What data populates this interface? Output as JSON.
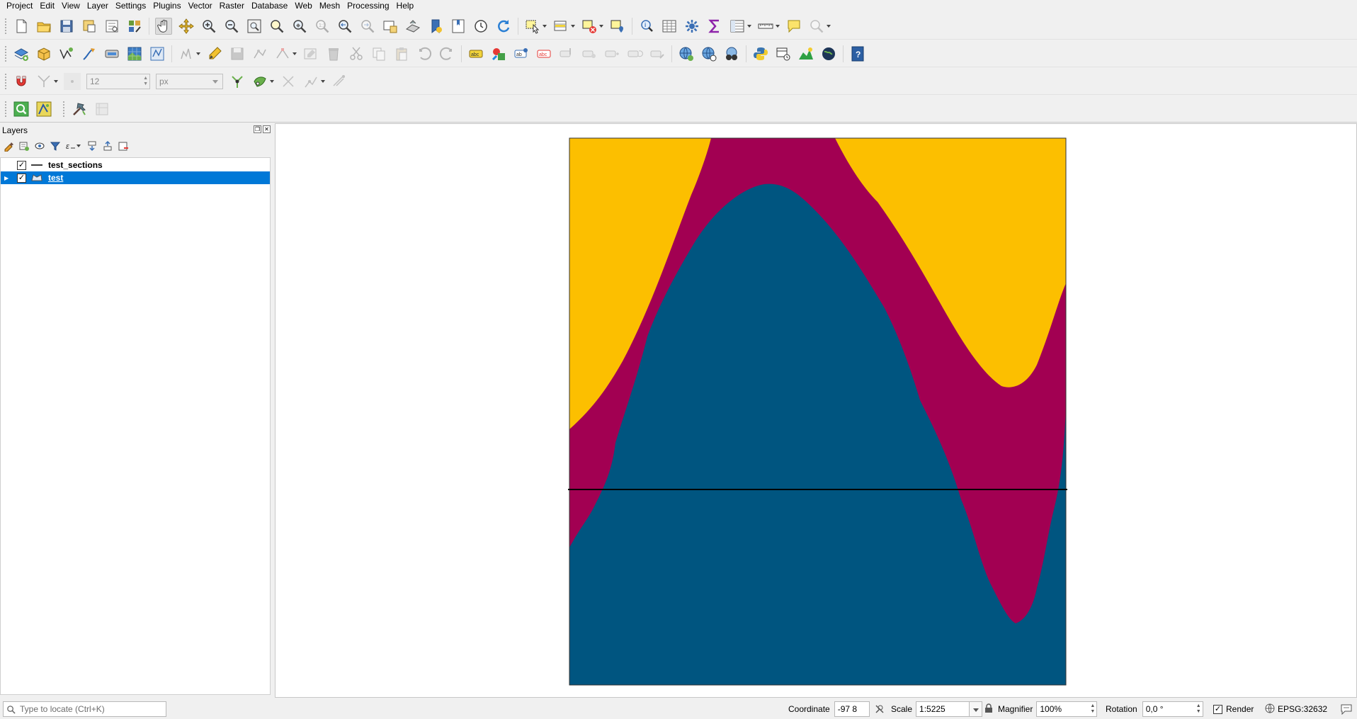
{
  "menubar": {
    "items": [
      "Project",
      "Edit",
      "View",
      "Layer",
      "Settings",
      "Plugins",
      "Vector",
      "Raster",
      "Database",
      "Web",
      "Mesh",
      "Processing",
      "Help"
    ]
  },
  "toolbars": {
    "snapping": {
      "tolerance_value": "12",
      "tolerance_unit": "px"
    }
  },
  "layers_panel": {
    "title": "Layers",
    "layers": [
      {
        "name": "test_sections",
        "checked": true,
        "symbol": "line-symbol",
        "selected": false
      },
      {
        "name": "test",
        "checked": true,
        "symbol": "polygon-symbol",
        "selected": true
      }
    ]
  },
  "map": {
    "layer_colors": {
      "top_unit": "#fcbf00",
      "middle_unit": "#a20052",
      "bottom_unit": "#005580",
      "section_line": "#000000"
    }
  },
  "statusbar": {
    "locator_placeholder": "Type to locate (Ctrl+K)",
    "coordinate_label": "Coordinate",
    "coordinate_value": "-97 8",
    "scale_label": "Scale",
    "scale_value": "1:5225",
    "magnifier_label": "Magnifier",
    "magnifier_value": "100%",
    "rotation_label": "Rotation",
    "rotation_value": "0,0 °",
    "render_label": "Render",
    "render_checked": true,
    "crs_label": "EPSG:32632"
  }
}
